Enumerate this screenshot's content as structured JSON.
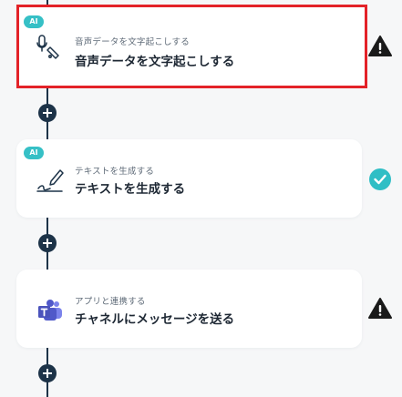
{
  "flow": {
    "steps": [
      {
        "badge": "AI",
        "icon": "microphone-icon",
        "subtitle": "音声データを文字起こしする",
        "title": "音声データを文字起こしする",
        "status": "warning"
      },
      {
        "badge": "AI",
        "icon": "pen-signature-icon",
        "subtitle": "テキストを生成する",
        "title": "テキストを生成する",
        "status": "complete"
      },
      {
        "badge": "",
        "icon": "microsoft-teams-icon",
        "subtitle": "アプリと連携する",
        "title": "チャネルにメッセージを送る",
        "status": "warning"
      }
    ]
  },
  "colors": {
    "selected_border": "#e32228",
    "ai_badge": "#36c0c6",
    "complete": "#2fbec5",
    "warning": "#1a1a1a",
    "connector": "#1d3348",
    "teams": "#5059c9"
  }
}
